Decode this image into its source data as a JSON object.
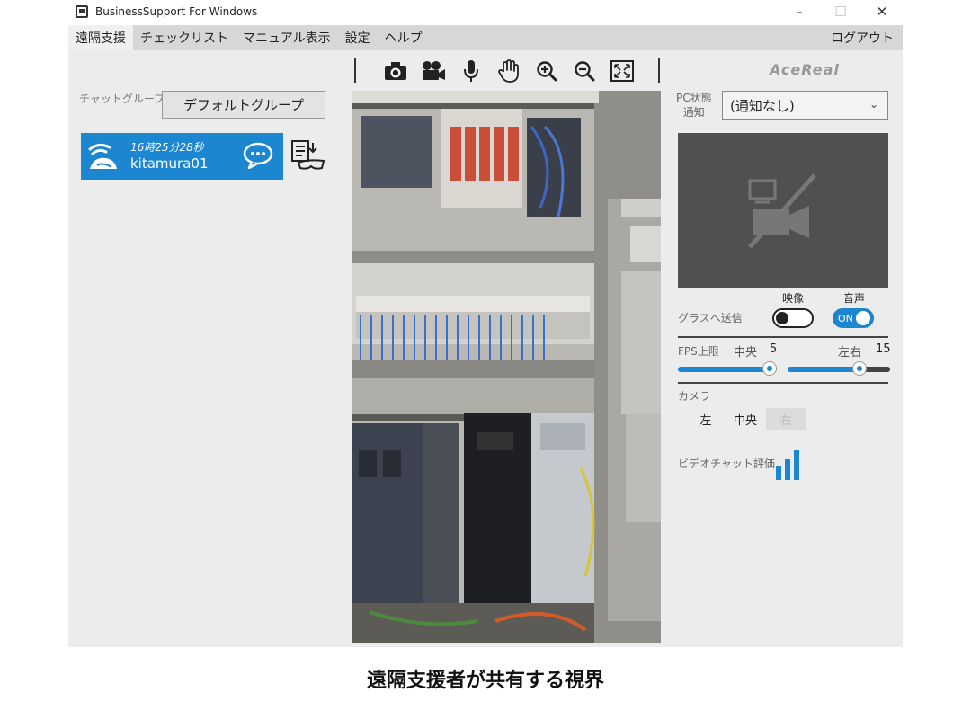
{
  "window": {
    "title": "BusinessSupport For Windows",
    "minimize": "–",
    "maximize": "☐",
    "close": "✕"
  },
  "menu": {
    "items": [
      "遠隔支援",
      "チェックリスト",
      "マニュアル表示",
      "設定",
      "ヘルプ"
    ],
    "active_index": 0,
    "logout": "ログアウト"
  },
  "left": {
    "chat_group_label": "チャットグループ",
    "group_button": "デフォルトグループ",
    "user": {
      "time": "16時25分28秒",
      "name": "kitamura01"
    }
  },
  "toolbar": {
    "icons": [
      "camera-icon",
      "video-camera-icon",
      "microphone-icon",
      "hand-icon",
      "zoom-in-icon",
      "zoom-out-icon",
      "fit-screen-icon"
    ]
  },
  "right": {
    "brand": "AceReal",
    "pc_status_label_1": "PC状態",
    "pc_status_label_2": "通知",
    "pc_status_value": "(通知なし)",
    "send_to_glasses_label": "グラスへ送信",
    "video_label": "映像",
    "audio_label": "音声",
    "video_toggle": false,
    "audio_toggle": true,
    "audio_toggle_text": "ON",
    "fps_label": "FPS上限",
    "fps_center_label": "中央",
    "fps_center_value": "5",
    "fps_side_label": "左右",
    "fps_side_value": "15",
    "fps_center_fraction": 0.93,
    "fps_side_fraction": 0.7,
    "camera_label": "カメラ",
    "camera_options": [
      "左",
      "中央",
      "右"
    ],
    "camera_disabled_index": 2,
    "rating_label": "ビデオチャット評価"
  },
  "colors": {
    "accent": "#1c86d1",
    "menubar": "#d7d7d7",
    "panel": "#ececec"
  },
  "caption": "遠隔支援者が共有する視界"
}
